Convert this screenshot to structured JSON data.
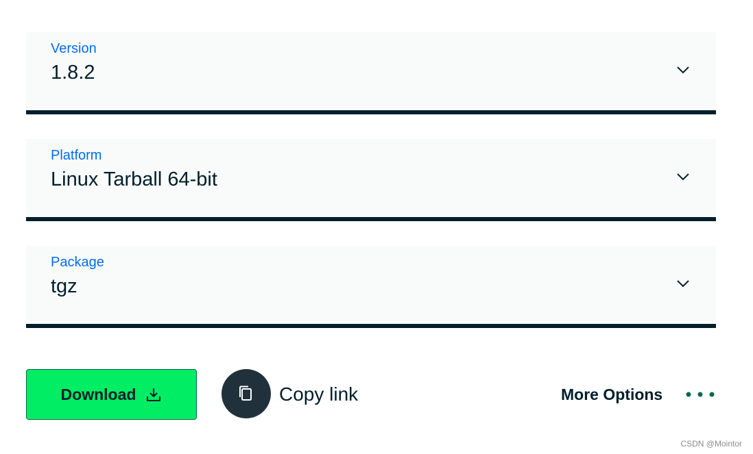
{
  "selects": {
    "version": {
      "label": "Version",
      "value": "1.8.2"
    },
    "platform": {
      "label": "Platform",
      "value": "Linux Tarball 64-bit"
    },
    "package": {
      "label": "Package",
      "value": "tgz"
    }
  },
  "actions": {
    "download_label": "Download",
    "copy_link_label": "Copy link",
    "more_options_label": "More Options"
  },
  "watermark": "CSDN @Mointor",
  "icons": {
    "dropdown": "chevron-down-icon",
    "download": "download-icon",
    "copy": "copy-icon",
    "more": "ellipsis-icon"
  },
  "colors": {
    "label_blue": "#016bf8",
    "text_dark": "#001e2b",
    "field_bg": "#f9fbfa",
    "download_green": "#00ed64",
    "dots_green": "#00684a",
    "copy_circle": "#21313c"
  }
}
